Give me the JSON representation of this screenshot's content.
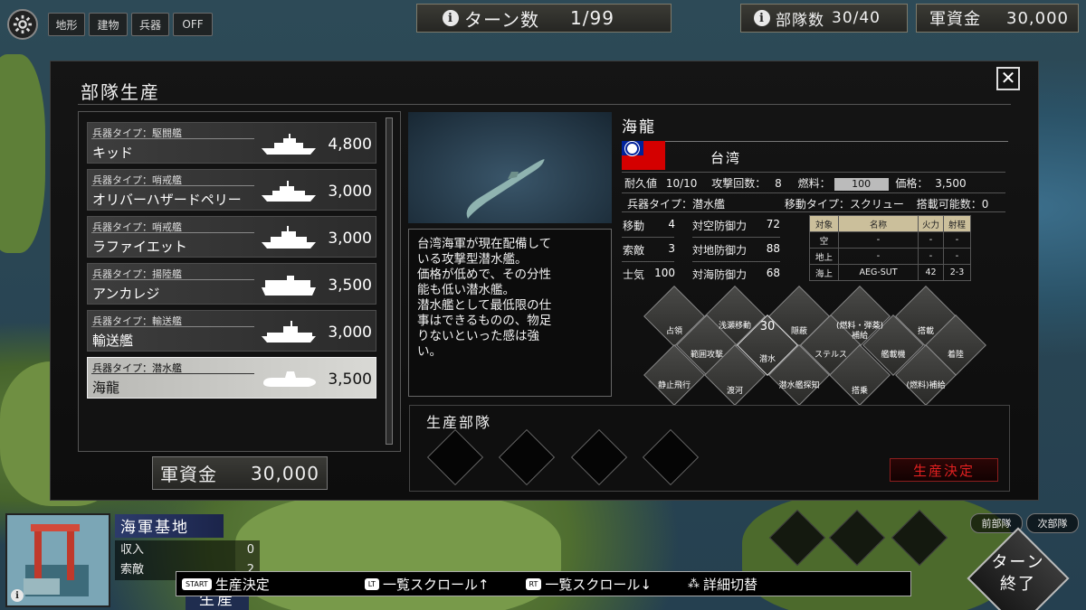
{
  "topbar": {
    "filters": [
      "地形",
      "建物",
      "兵器",
      "OFF"
    ],
    "turn_label": "ターン数",
    "turn_value": "1/99",
    "units_label": "部隊数",
    "units_value": "30/40",
    "funds_label": "軍資金",
    "funds_value": "30,000"
  },
  "dialog": {
    "title": "部隊生産",
    "close_glyph": "✕",
    "units": [
      {
        "type": "兵器タイプ：駆闘艦",
        "name": "キッド",
        "price": "4,800"
      },
      {
        "type": "兵器タイプ：哨戒艦",
        "name": "オリバーハザードペリー",
        "price": "3,000"
      },
      {
        "type": "兵器タイプ：哨戒艦",
        "name": "ラファイエット",
        "price": "3,000"
      },
      {
        "type": "兵器タイプ：揚陸艦",
        "name": "アンカレジ",
        "price": "3,500"
      },
      {
        "type": "兵器タイプ：輸送艦",
        "name": "輸送艦",
        "price": "3,000"
      },
      {
        "type": "兵器タイプ：潜水艦",
        "name": "海龍",
        "price": "3,500"
      }
    ],
    "funds_label": "軍資金",
    "funds_value": "30,000",
    "description": [
      "台湾海軍が現在配備して",
      "いる攻撃型潜水艦。",
      "価格が低めで、その分性",
      "能も低い潜水艦。",
      "潜水艦として最低限の仕",
      "事はできるものの、物足",
      "りないといった感は強",
      "い。",
      ""
    ],
    "detail": {
      "name": "海龍",
      "nation": "台湾",
      "durability_label": "耐久値",
      "durability": "10/10",
      "attacks_label": "攻撃回数：",
      "attacks": "8",
      "fuel_label": "燃料：",
      "fuel": "100",
      "price_label": "価格：",
      "price": "3,500",
      "weapon_type": "兵器タイプ：潜水艦",
      "move_type": "移動タイプ：スクリュー",
      "capacity": "搭載可能数：0",
      "stats": [
        {
          "label": "移動",
          "value": "4"
        },
        {
          "label": "索敵",
          "value": "3"
        },
        {
          "label": "士気",
          "value": "100"
        },
        {
          "label": "対空防御力",
          "value": "72"
        },
        {
          "label": "対地防御力",
          "value": "88"
        },
        {
          "label": "対海防御力",
          "value": "68"
        }
      ],
      "weapon_table": {
        "headers": [
          "対象",
          "名称",
          "火力",
          "射程"
        ],
        "rows": [
          [
            "空",
            "-",
            "-",
            "-"
          ],
          [
            "地上",
            "-",
            "-",
            "-"
          ],
          [
            "海上",
            "AEG-SUT",
            "42",
            "2-3"
          ]
        ]
      }
    },
    "abilities": [
      "占領",
      "浅瀬移動",
      "隠蔽",
      "(燃料・弾薬)補給",
      "搭載",
      "範囲攻撃",
      "潜水",
      "ステルス",
      "艦載機",
      "着陸",
      "静止飛行",
      "渡河",
      "潜水艦探知",
      "搭乗",
      "(燃料)補給"
    ],
    "dive_count": "30",
    "queue_title": "生産部隊",
    "confirm_label": "生産決定"
  },
  "base": {
    "name": "海軍基地",
    "income_label": "収入",
    "income_value": "0",
    "search_label": "索敵",
    "search_value": "2",
    "produce_tab": "生産"
  },
  "nav": {
    "prev": "前部隊",
    "next": "次部隊",
    "end_turn_1": "ターン",
    "end_turn_2": "終了"
  },
  "help": [
    {
      "key": "START",
      "label": "生産決定"
    },
    {
      "key": "LT",
      "label": "一覧スクロール↑"
    },
    {
      "key": "RT",
      "label": "一覧スクロール↓"
    },
    {
      "key": "⁂",
      "label": "詳細切替"
    }
  ]
}
